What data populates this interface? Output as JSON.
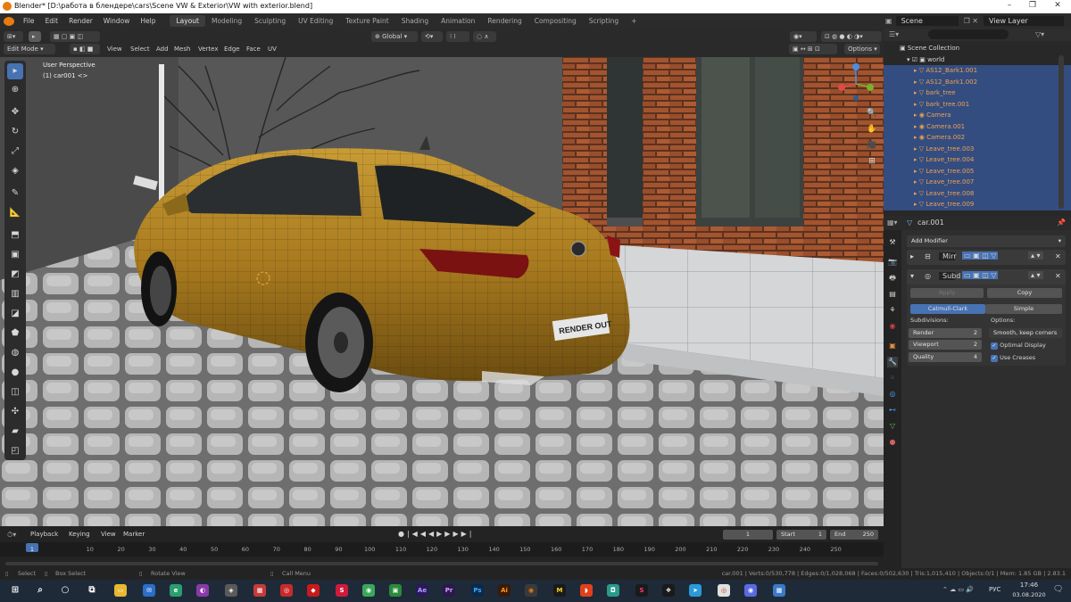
{
  "window": {
    "title": "Blender* [D:\\работа в блендере\\cars\\Scene VW & Exterior\\VW with exterior.blend]"
  },
  "menu": [
    "File",
    "Edit",
    "Render",
    "Window",
    "Help"
  ],
  "workspaces": [
    "Layout",
    "Modeling",
    "Sculpting",
    "UV Editing",
    "Texture Paint",
    "Shading",
    "Animation",
    "Rendering",
    "Compositing",
    "Scripting"
  ],
  "scene": {
    "name": "Scene",
    "view_layer": "View Layer"
  },
  "header3d": {
    "mode": "Edit Mode",
    "menus": [
      "View",
      "Select",
      "Add",
      "Mesh",
      "Vertex",
      "Edge",
      "Face",
      "UV"
    ],
    "orientation": "Global",
    "options": "Options"
  },
  "viewport": {
    "perspective": "User Perspective",
    "object": "(1) car001 <>",
    "plate": "RENDER OUT"
  },
  "outliner": {
    "title": "Scene Collection",
    "root": "world",
    "items": [
      "AS12_Bark1.001",
      "AS12_Bark1.002",
      "bark_tree",
      "bark_tree.001",
      "Camera",
      "Camera.001",
      "Camera.002",
      "Leave_tree.003",
      "Leave_tree.004",
      "Leave_tree.005",
      "Leave_tree.007",
      "Leave_tree.008",
      "Leave_tree.009"
    ]
  },
  "properties": {
    "object": "car.001",
    "add_modifier": "Add Modifier",
    "mod1_name": "Mirr",
    "mod2_name": "Subd",
    "apply": "Apply",
    "copy": "Copy",
    "catmull": "Catmull-Clark",
    "simple": "Simple",
    "subdivisions_label": "Subdivisions:",
    "options_label": "Options:",
    "render_label": "Render",
    "render_val": "2",
    "viewport_label": "Viewport",
    "viewport_val": "2",
    "quality_label": "Quality",
    "quality_val": "4",
    "uv_smooth": "Smooth, keep corners",
    "optimal_display": "Optimal Display",
    "use_creases": "Use Creases"
  },
  "timeline": {
    "menus": [
      "Playback",
      "Keying",
      "View",
      "Marker"
    ],
    "current": "1",
    "start_label": "Start",
    "start": "1",
    "end_label": "End",
    "end": "250",
    "ticks": [
      "1",
      "10",
      "20",
      "30",
      "40",
      "50",
      "60",
      "70",
      "80",
      "90",
      "100",
      "110",
      "120",
      "130",
      "140",
      "150",
      "160",
      "170",
      "180",
      "190",
      "200",
      "210",
      "220",
      "230",
      "240",
      "250"
    ]
  },
  "status": {
    "select": "Select",
    "box_select": "Box Select",
    "rotate": "Rotate View",
    "call_menu": "Call Menu",
    "stats": "car.001 | Verts:0/530,778 | Edges:0/1,028,068 | Faces:0/502,630 | Tris:1,015,410 | Objects:0/1 | Mem: 1.85 GB | 2.83.1"
  },
  "taskbar": {
    "lang": "РУС",
    "time": "17:46",
    "date": "03.08.2020"
  },
  "colors": {
    "accent": "#4772b3",
    "blender_orange": "#e87d0d",
    "outliner_sel": "#334d80",
    "object_orange": "#e8a040"
  }
}
